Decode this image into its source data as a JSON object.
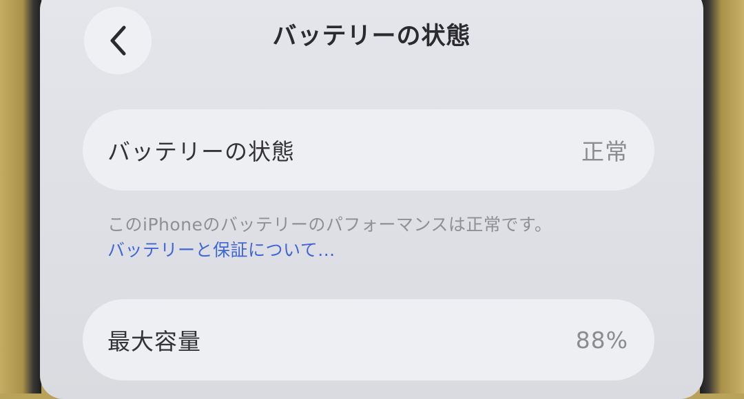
{
  "nav": {
    "title": "バッテリーの状態",
    "back_icon": "chevron-left-icon"
  },
  "battery_state": {
    "label": "バッテリーの状態",
    "value": "正常"
  },
  "footer": {
    "description": "このiPhoneのバッテリーのパフォーマンスは正常です。",
    "link": "バッテリーと保証について..."
  },
  "max_capacity": {
    "label": "最大容量",
    "value": "88%"
  },
  "colors": {
    "link": "#3e66d6",
    "value_gray": "#8c8c90",
    "background": "#e4e6eb"
  }
}
